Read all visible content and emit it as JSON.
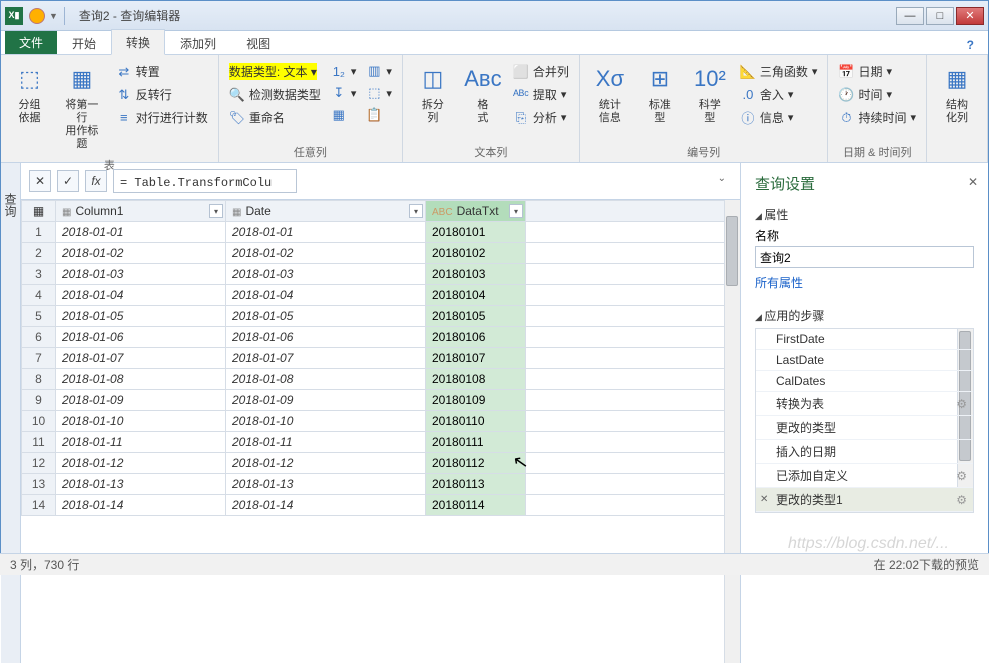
{
  "window": {
    "title": "查询2 - 查询编辑器"
  },
  "tabs": {
    "file": "文件",
    "t0": "开始",
    "t1": "转换",
    "t2": "添加列",
    "t3": "视图"
  },
  "ribbon": {
    "g1": {
      "label": "表",
      "b1": "分组\n依据",
      "b2": "将第一行\n用作标题",
      "s1": "转置",
      "s2": "反转行",
      "s3": "对行进行计数"
    },
    "g2": {
      "label": "任意列",
      "hl": "数据类型: 文本",
      "s2": "检测数据类型",
      "s3": "重命名"
    },
    "g3": {
      "label": "文本列",
      "b1": "拆分\n列",
      "b2": "格\n式",
      "s1": "合并列",
      "s2": "提取",
      "s3": "分析"
    },
    "g4": {
      "label": "编号列",
      "b1": "统计\n信息",
      "b2": "标准\n型",
      "b3": "科学\n型",
      "s1": "三角函数",
      "s2": "舍入",
      "s3": "信息"
    },
    "g5": {
      "label": "日期 & 时间列",
      "s1": "日期",
      "s2": "时间",
      "s3": "持续时间"
    },
    "g6": {
      "label": "",
      "b1": "结构\n化列"
    }
  },
  "collapse": "查询",
  "formula": "= Table.TransformColumnTypes(已添加自定义,{{\"DataTxt\", type text}})",
  "cols": {
    "c1": "Column1",
    "c2": "Date",
    "c3": "DataTxt",
    "typ3": "ABC"
  },
  "rows": [
    {
      "n": "1",
      "c1": "2018-01-01",
      "c2": "2018-01-01",
      "c3": "20180101"
    },
    {
      "n": "2",
      "c1": "2018-01-02",
      "c2": "2018-01-02",
      "c3": "20180102"
    },
    {
      "n": "3",
      "c1": "2018-01-03",
      "c2": "2018-01-03",
      "c3": "20180103"
    },
    {
      "n": "4",
      "c1": "2018-01-04",
      "c2": "2018-01-04",
      "c3": "20180104"
    },
    {
      "n": "5",
      "c1": "2018-01-05",
      "c2": "2018-01-05",
      "c3": "20180105"
    },
    {
      "n": "6",
      "c1": "2018-01-06",
      "c2": "2018-01-06",
      "c3": "20180106"
    },
    {
      "n": "7",
      "c1": "2018-01-07",
      "c2": "2018-01-07",
      "c3": "20180107"
    },
    {
      "n": "8",
      "c1": "2018-01-08",
      "c2": "2018-01-08",
      "c3": "20180108"
    },
    {
      "n": "9",
      "c1": "2018-01-09",
      "c2": "2018-01-09",
      "c3": "20180109"
    },
    {
      "n": "10",
      "c1": "2018-01-10",
      "c2": "2018-01-10",
      "c3": "20180110"
    },
    {
      "n": "11",
      "c1": "2018-01-11",
      "c2": "2018-01-11",
      "c3": "20180111"
    },
    {
      "n": "12",
      "c1": "2018-01-12",
      "c2": "2018-01-12",
      "c3": "20180112"
    },
    {
      "n": "13",
      "c1": "2018-01-13",
      "c2": "2018-01-13",
      "c3": "20180113"
    },
    {
      "n": "14",
      "c1": "2018-01-14",
      "c2": "2018-01-14",
      "c3": "20180114"
    }
  ],
  "settings": {
    "title": "查询设置",
    "sect1": "属性",
    "name_lbl": "名称",
    "name_val": "查询2",
    "all_props": "所有属性",
    "sect2": "应用的步骤",
    "steps": [
      "FirstDate",
      "LastDate",
      "CalDates",
      "转换为表",
      "更改的类型",
      "插入的日期",
      "已添加自定义",
      "更改的类型1"
    ]
  },
  "status": {
    "left": "3 列，730 行",
    "right": "在 22:02下载的预览"
  }
}
